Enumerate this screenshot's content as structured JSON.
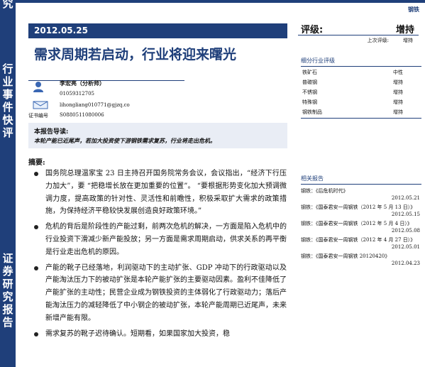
{
  "header": {
    "top_right": "钢铁",
    "left_vertical": {
      "top": "究",
      "middle": "行业事件快评",
      "bottom": "证券研究报告"
    }
  },
  "report": {
    "date": "2012.05.25",
    "title": "需求周期若启动，行业将迎来曙光"
  },
  "rating": {
    "label": "评级:",
    "value": "增持",
    "prev_label": "上次评级:",
    "prev_value": "增持"
  },
  "analyst": {
    "name": "李宏亮（分析师）",
    "phone": "01059312705",
    "email": "lihongliang010771@gjzq.co",
    "cert_label": "证书编号",
    "cert": "S0880511080006"
  },
  "industry_rating": {
    "title": "细分行业评级",
    "rows": [
      {
        "name": "铁矿石",
        "rating": "中性"
      },
      {
        "name": "普碳钢",
        "rating": "增持"
      },
      {
        "name": "不锈钢",
        "rating": "增持"
      },
      {
        "name": "特殊钢",
        "rating": "增持"
      },
      {
        "name": "钢铁制品",
        "rating": "增持"
      }
    ]
  },
  "guide": {
    "title": "本报告导读:",
    "text": "本轮产能已近尾声，若加大投资使下游钢铁需求复苏，行业将走出危机。"
  },
  "summary": {
    "title": "摘要:",
    "bullets": [
      "国务院总理温家宝 23 日主持召开国务院常务会议，会议指出，“经济下行压力加大”，要 “把稳增长放在更加重要的位置”。 “要根据形势变化加大预调微调力度，提高政策的针对性、灵活性和前瞻性，积极采取扩大需求的政策措施，为保持经济平稳较快发展创造良好政策环境。”",
      "危机的背后是阶段性的产能过剩，前两次危机的解决，一方面是陷入危机中的行业投资下滑减少新产能投放；另一方面是需求周期启动，供求关系的再平衡是行业走出危机的原因。",
      "产能的靴子已经落地，利润驱动下的主动扩张、GDP 冲动下的行政驱动以及产能淘汰压力下的被动扩张是本轮产能扩张的主要驱动因素。盈利不佳降低了产能扩张的主动性；民营企业成为钢铁投资的主体弱化了行政驱动力；落后产能淘汰压力的减轻降低了中小钢企的被动扩张，本轮产能周期已近尾声，未来新增产能有限。",
      "需求复苏的靴子迟待确认。短期看，如果国家加大投资，稳"
    ]
  },
  "related": {
    "title": "相关报告",
    "items": [
      {
        "text": "钢铁：《后危机时代》",
        "date": "2012.05.21"
      },
      {
        "text": "钢铁：《国泰君安一周钢铁（2012 年 5 月 13 日）》",
        "date": "2012.05.15"
      },
      {
        "text": "钢铁：《国泰君安一周钢铁（2012 年 5 月 4 日）》",
        "date": "2012.05.08"
      },
      {
        "text": "钢铁：《国泰君安一周钢铁（2012 年 4 月 27 日）》",
        "date": "2012.05.01"
      },
      {
        "text": "钢铁：《国泰君安一周钢铁 20120420》",
        "date": "2012.04.23"
      }
    ]
  },
  "colors": {
    "brand": "#1f3f7a"
  }
}
